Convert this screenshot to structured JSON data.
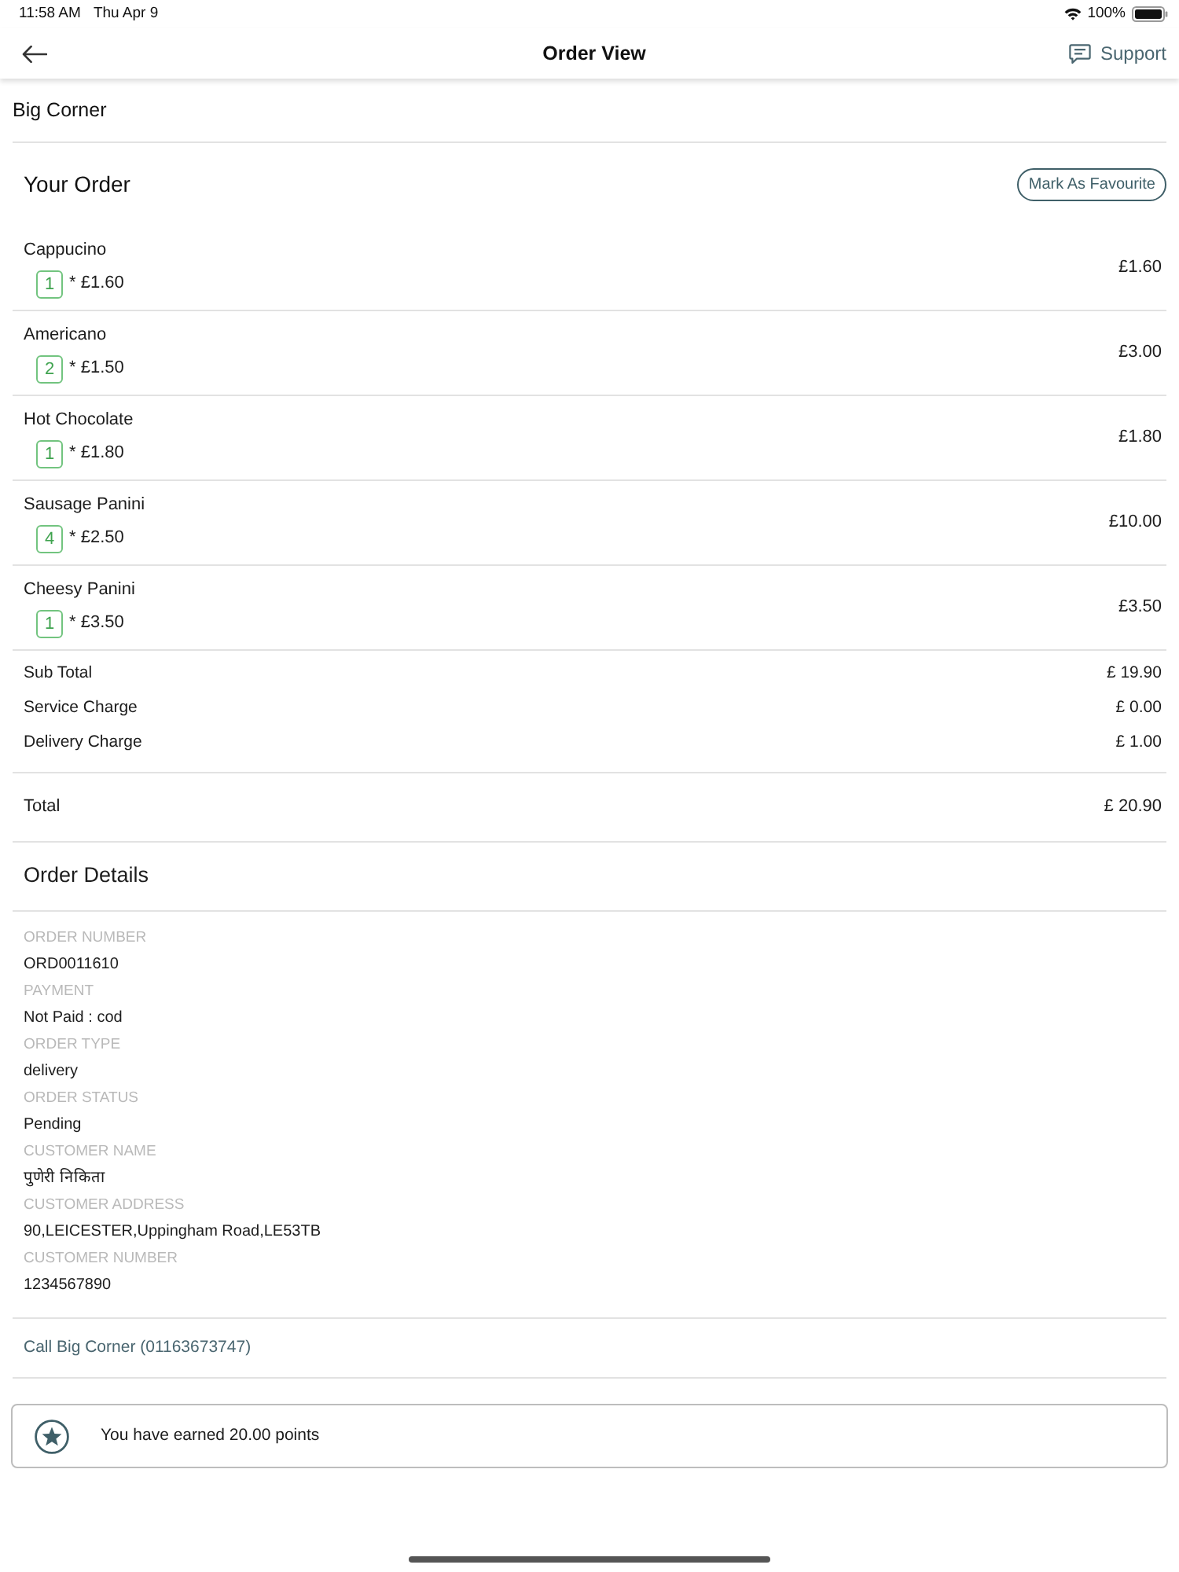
{
  "status_bar": {
    "time": "11:58 AM",
    "date": "Thu Apr 9",
    "battery": "100%"
  },
  "header": {
    "title": "Order View",
    "support": "Support"
  },
  "store_name": "Big Corner",
  "order": {
    "title": "Your Order",
    "favourite_button": "Mark As Favourite",
    "items": [
      {
        "name": "Cappucino",
        "quantity": "1",
        "unit_price": "* £1.60",
        "price": "£1.60"
      },
      {
        "name": "Americano",
        "quantity": "2",
        "unit_price": "* £1.50",
        "price": "£3.00"
      },
      {
        "name": "Hot Chocolate",
        "quantity": "1",
        "unit_price": "* £1.80",
        "price": "£1.80"
      },
      {
        "name": "Sausage Panini",
        "quantity": "4",
        "unit_price": "* £2.50",
        "price": "£10.00"
      },
      {
        "name": "Cheesy Panini",
        "quantity": "1",
        "unit_price": "* £3.50",
        "price": "£3.50"
      }
    ]
  },
  "charges": [
    {
      "label": "Sub Total",
      "value": "£ 19.90"
    },
    {
      "label": "Service Charge",
      "value": "£ 0.00"
    },
    {
      "label": "Delivery Charge",
      "value": "£ 1.00"
    }
  ],
  "total": {
    "label": "Total",
    "value": "£ 20.90"
  },
  "details": {
    "title": "Order Details",
    "fields": [
      {
        "label": "ORDER NUMBER",
        "value": "ORD0011610"
      },
      {
        "label": "PAYMENT",
        "value": "Not Paid : cod"
      },
      {
        "label": "ORDER TYPE",
        "value": "delivery"
      },
      {
        "label": "ORDER STATUS",
        "value": "Pending"
      },
      {
        "label": "CUSTOMER NAME",
        "value": "पुणेरी निकिता"
      },
      {
        "label": "CUSTOMER ADDRESS",
        "value": "90,LEICESTER,Uppingham Road,LE53TB"
      },
      {
        "label": "CUSTOMER NUMBER",
        "value": "1234567890"
      }
    ]
  },
  "call_link": "Call Big Corner (01163673747)",
  "points": {
    "message": "You have earned 20.00 points"
  }
}
